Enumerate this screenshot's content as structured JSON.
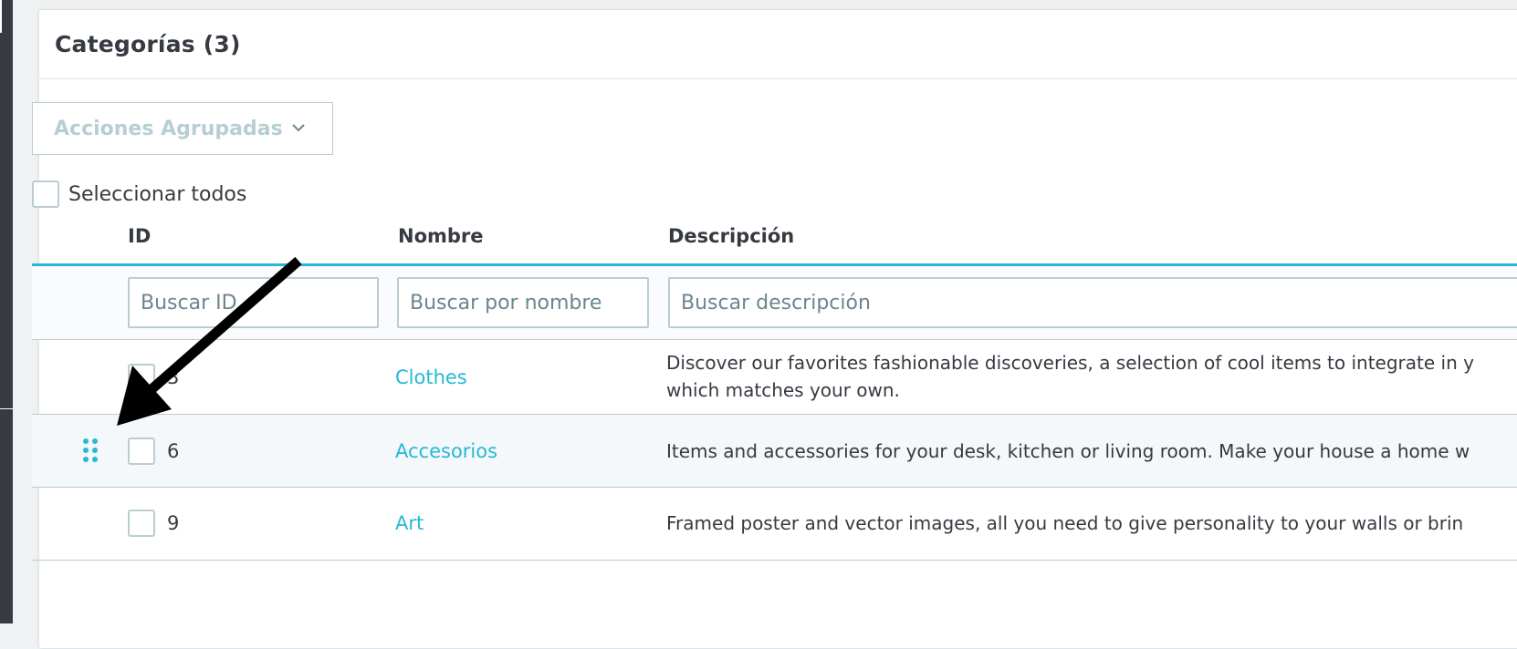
{
  "panel": {
    "title": "Categorías (3)"
  },
  "bulk_actions": {
    "label": "Acciones Agrupadas",
    "icon": "chevron-down-icon"
  },
  "select_all": {
    "label": "Seleccionar todos"
  },
  "table": {
    "headers": {
      "id": "ID",
      "name": "Nombre",
      "description": "Descripción"
    },
    "filters": {
      "id_placeholder": "Buscar ID",
      "name_placeholder": "Buscar por nombre",
      "description_placeholder": "Buscar descripción"
    },
    "rows": [
      {
        "id": "3",
        "name": "Clothes",
        "description_line1": "Discover our favorites fashionable discoveries, a selection of cool items to integrate in y",
        "description_line2": "which matches your own."
      },
      {
        "id": "6",
        "name": "Accesorios",
        "description_line1": "Items and accessories for your desk, kitchen or living room. Make your house a home w"
      },
      {
        "id": "9",
        "name": "Art",
        "description_line1": "Framed poster and vector images, all you need to give personality to your walls or brin"
      }
    ]
  },
  "colors": {
    "accent": "#25b9d7",
    "border": "#bbcdd2",
    "text": "#363a41",
    "sidebar": "#363a41"
  },
  "icons": {
    "drag_handle": "drag-handle-icon",
    "annotation": "arrow-annotation"
  }
}
